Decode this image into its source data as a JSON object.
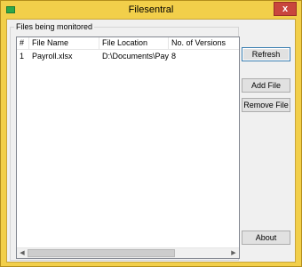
{
  "window": {
    "title": "Filesentral",
    "close_glyph": "x",
    "accent_color": "#f2cf4a",
    "close_color": "#c9463d"
  },
  "group": {
    "label": "Files being monitored"
  },
  "table": {
    "columns": [
      "#",
      "File Name",
      "File Location",
      "No. of Versions"
    ],
    "rows": [
      [
        "1",
        "Payroll.xlsx",
        "D:\\Documents\\Pay...",
        "8"
      ]
    ]
  },
  "scrollbar": {
    "left_glyph": "◀",
    "right_glyph": "▶"
  },
  "buttons": {
    "refresh": "Refresh",
    "add_file": "Add File",
    "remove_file": "Remove File",
    "about": "About"
  },
  "icons": {
    "app": "app-icon",
    "close": "close-icon"
  }
}
